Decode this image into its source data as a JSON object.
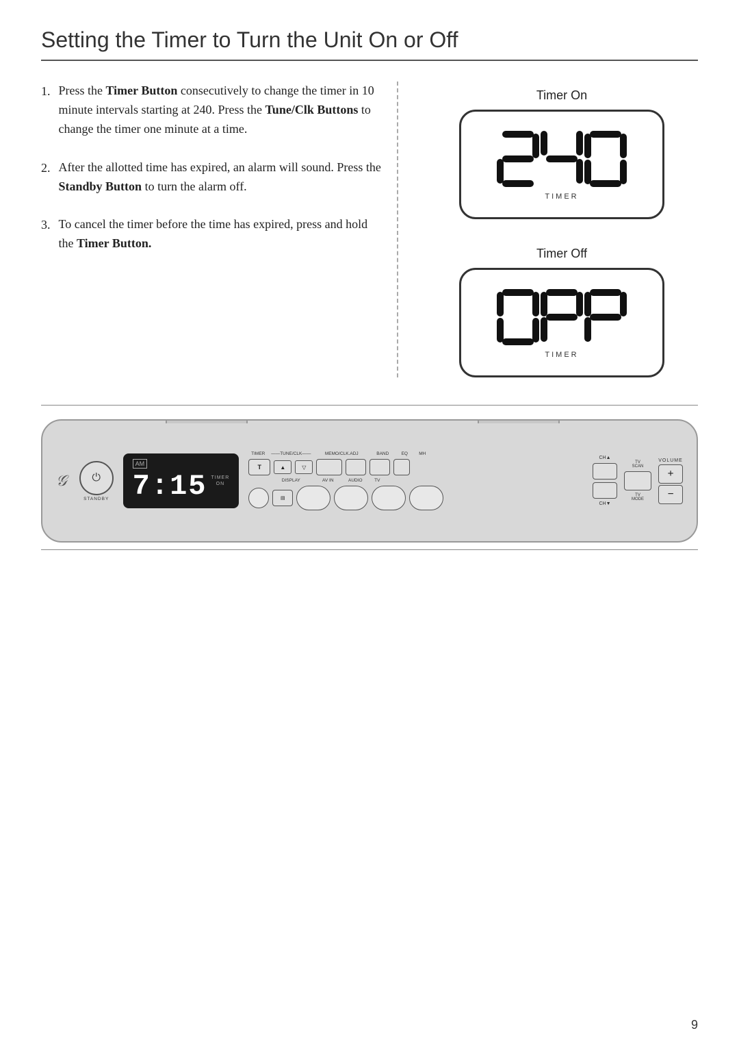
{
  "page": {
    "title": "Setting the Timer to Turn the Unit On or Off",
    "page_number": "9"
  },
  "instructions": [
    {
      "num": "1.",
      "text_parts": [
        {
          "text": "Press the ",
          "bold": false
        },
        {
          "text": "Timer Button",
          "bold": true
        },
        {
          "text": " consecutively to change the timer in 10 minute intervals starting at 240.  Press the ",
          "bold": false
        },
        {
          "text": "Tune/Clk Buttons",
          "bold": true
        },
        {
          "text": " to change the timer one minute at a time.",
          "bold": false
        }
      ]
    },
    {
      "num": "2.",
      "text_parts": [
        {
          "text": "After the allotted time has expired, an alarm will sound.  Press the ",
          "bold": false
        },
        {
          "text": "Standby Button",
          "bold": true
        },
        {
          "text": " to turn the alarm off.",
          "bold": false
        }
      ]
    },
    {
      "num": "3.",
      "text_parts": [
        {
          "text": "To cancel the timer before the time has expired, press and hold the ",
          "bold": false
        },
        {
          "text": "Timer Button.",
          "bold": true
        }
      ]
    }
  ],
  "timer_on": {
    "label": "Timer On",
    "display_value": "240",
    "sub_label": "TIMER"
  },
  "timer_off": {
    "label": "Timer Off",
    "display_value": "OFF",
    "sub_label": "TIMER"
  },
  "device": {
    "standby_label": "STANDBY",
    "am_label": "AM",
    "clock_time": "7:15",
    "timer_on_label": "TIMER\nON",
    "volume_label": "VOLUME",
    "plus_label": "+",
    "minus_label": "−",
    "ch_up": "CH▲",
    "ch_down": "CH▼",
    "scan_label": "TV\nSCAN",
    "mode_label": "TV\nMODE",
    "button_labels": {
      "timer": "TIMER",
      "tune_clk": "TUNE/CLK",
      "memo_clk_adj": "MEMO/CLK.ADJ",
      "band": "BAND",
      "eq": "EQ",
      "mh": "MH",
      "display": "DISPLAY",
      "av_in": "AV IN",
      "audio": "AUDIO",
      "tv": "TV"
    }
  }
}
